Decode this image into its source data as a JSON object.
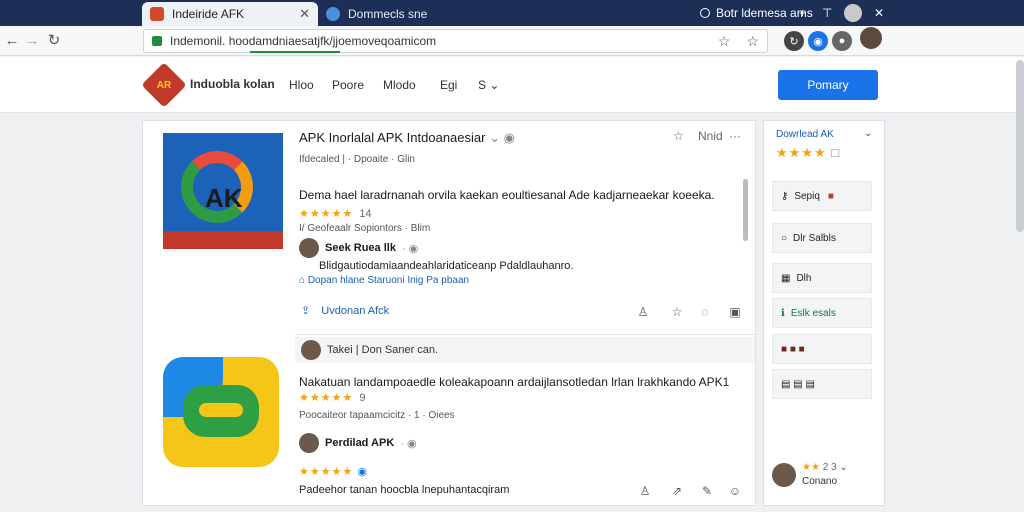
{
  "browser": {
    "active_tab_title": "Indeiride AFK",
    "inactive_tab_title": "Dommecls sne",
    "right_tab_title": "Botr ldemesa ams",
    "address": "Indemonil. hoodamdniaesatjfk/jjoemoveqoamicom"
  },
  "site": {
    "name": "Induobla kolan",
    "logo_text": "AR",
    "menu": [
      "Hloo",
      "Poore",
      "Mlodo",
      "Egi",
      "S"
    ],
    "primary_button": "Pomary"
  },
  "post1": {
    "title": "APK Inorlalal APK Intdoanaesiar",
    "more_label": "Nnid",
    "meta": "Ifdecaled | · Dpoaite · Glin",
    "body": "Dema hael laradrnanah orvila kaekan eoultiesanal Ade kadjarneaekar koeeka.",
    "rating": "14",
    "meta2": "I/ Geofeaalr Sopiontors · Blim",
    "user": "Seek Ruea llk",
    "desc": "Blidgautiodamiaandeahlaridaticeanp Pdaldlauhanro.",
    "desc2": "Dopan hlane Staruoni Inig Pa pbaan",
    "action_link": "Uvdonan Afck"
  },
  "comment": {
    "text": "Takei | Don Saner can."
  },
  "post2": {
    "body": "Nakatuan landampoaedle koleakapoann ardaijlansotledan lrlan lrakhkando APK1",
    "rating": "9",
    "meta": "Poocaiteor tapaamcicitz · 1 · Oiees",
    "user": "Perdilad APK",
    "footer_text": "Padeehor tanan hoocbla lnepuhantacqiram"
  },
  "sidebar": {
    "heading": "Dowrlead AK",
    "items": [
      "Sepiq",
      "Dlr Salbls",
      "Dlh",
      "Eslk esals",
      "",
      ""
    ],
    "bottom_text": "Conano",
    "bottom_rating": "2 3"
  }
}
